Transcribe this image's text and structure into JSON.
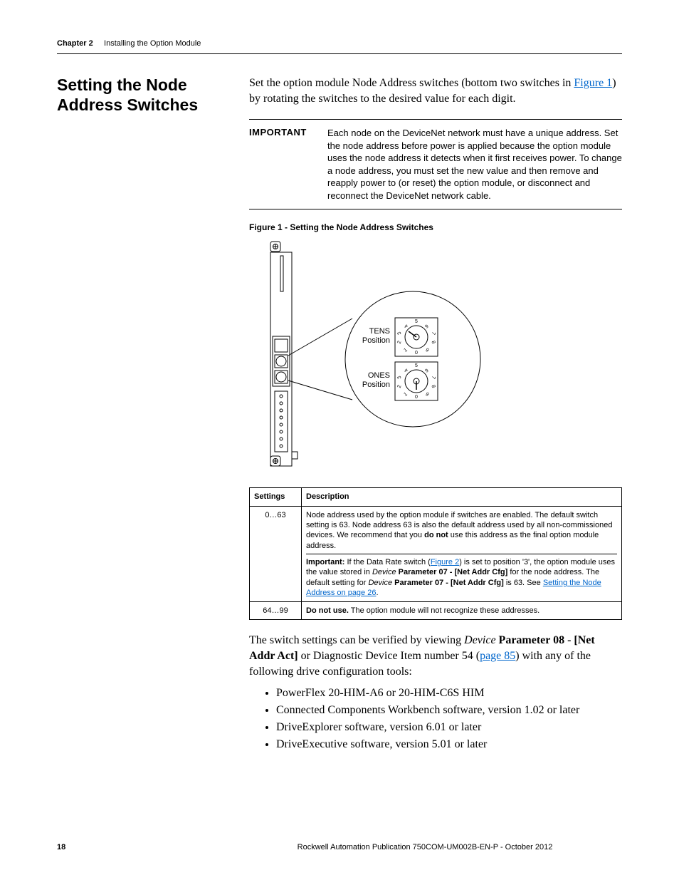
{
  "runhead": {
    "chapter": "Chapter 2",
    "title": "Installing the Option Module"
  },
  "section_heading": "Setting the Node Address Switches",
  "intro": {
    "pre_link": "Set the option module Node Address switches (bottom two switches in ",
    "link": "Figure 1",
    "post_link": ") by rotating the switches to the desired value for each digit."
  },
  "important": {
    "label": "IMPORTANT",
    "text": "Each node on the DeviceNet network must have a unique address. Set the node address before power is applied because the option module uses the node address it detects when it first receives power. To change a node address, you must set the new value and then remove and reapply power to (or reset) the option module, or disconnect and reconnect the DeviceNet network cable."
  },
  "figure": {
    "caption": "Figure 1 - Setting the Node Address Switches",
    "tens_label": "TENS",
    "ones_label": "ONES",
    "position_word": "Position",
    "dial_numbers": [
      "0",
      "1",
      "2",
      "3",
      "4",
      "5",
      "6",
      "7",
      "8",
      "9"
    ]
  },
  "table": {
    "headers": {
      "settings": "Settings",
      "description": "Description"
    },
    "rows": [
      {
        "settings": "0…63",
        "desc_p1_a": "Node address used by the option module if switches are enabled. The default switch setting is 63. Node address 63 is also the default address used by all non-commissioned devices. We recommend that you ",
        "desc_p1_bold": "do not",
        "desc_p1_b": " use this address as the final option module address.",
        "desc_p2_a": "Important:",
        "desc_p2_b": " If the Data Rate switch (",
        "desc_p2_link1": "Figure 2",
        "desc_p2_c": ") is set to position '3', the option module uses the value stored in ",
        "desc_p2_ital1": "Device",
        "desc_p2_bold2": " Parameter 07 - [Net Addr Cfg]",
        "desc_p2_d": " for the node address. The default setting for ",
        "desc_p2_ital2": "Device",
        "desc_p2_bold3": " Parameter 07 - [Net Addr Cfg]",
        "desc_p2_e": " is 63. See ",
        "desc_p2_link2": "Setting the Node Address on page 26",
        "desc_p2_f": "."
      },
      {
        "settings": "64…99",
        "desc_bold": "Do not use.",
        "desc_rest": " The option module will not recognize these addresses."
      }
    ]
  },
  "post_para": {
    "a": "The switch settings can be verified by viewing ",
    "ital": "Device",
    "bold": " Parameter 08 - [Net Addr Act]",
    "b": " or Diagnostic Device Item number 54 (",
    "link": "page 85",
    "c": ") with any of the following drive configuration tools:"
  },
  "tools": [
    "PowerFlex 20-HIM-A6 or 20-HIM-C6S HIM",
    "Connected Components Workbench software, version 1.02 or later",
    "DriveExplorer software, version 6.01 or later",
    "DriveExecutive software, version 5.01 or later"
  ],
  "footer": {
    "page": "18",
    "pub": "Rockwell Automation Publication 750COM-UM002B-EN-P - October 2012"
  }
}
